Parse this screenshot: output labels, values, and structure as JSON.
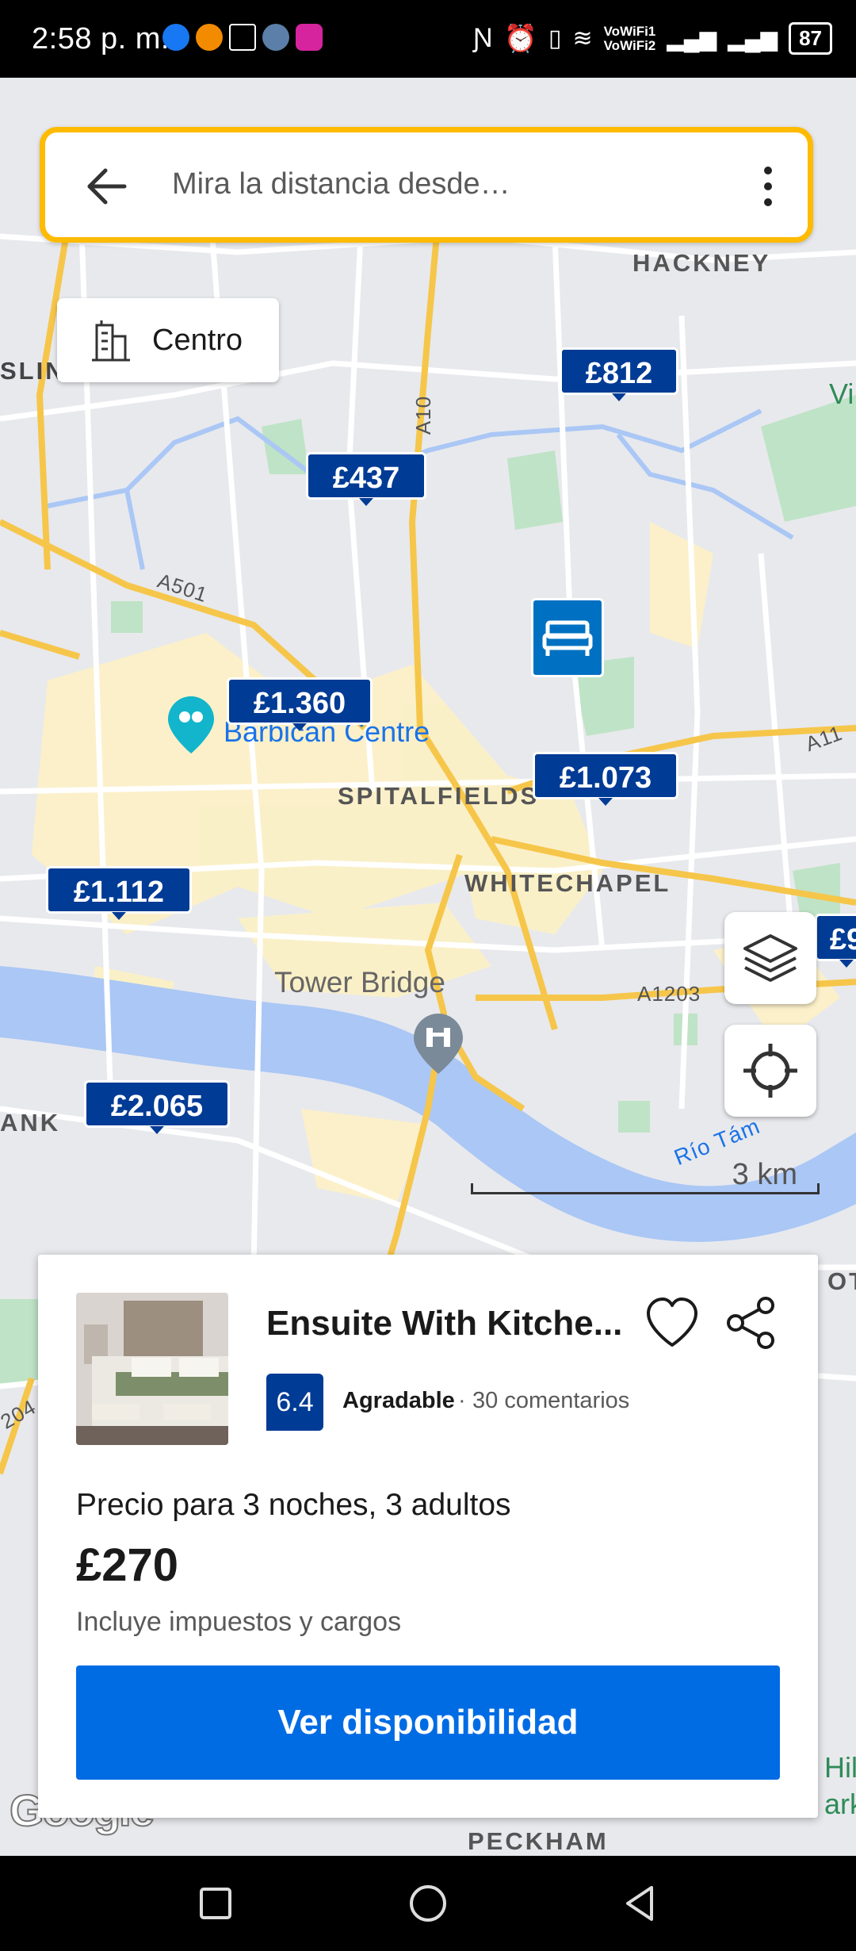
{
  "status_bar": {
    "time": "2:58 p. m.",
    "network_label_1": "VoWiFi1",
    "network_label_2": "VoWiFi2",
    "battery": "87"
  },
  "search": {
    "placeholder": "Mira la distancia desde…"
  },
  "centro_button": {
    "label": "Centro",
    "icon": "buildings-icon"
  },
  "map": {
    "labels": {
      "hackney": "HACKNEY",
      "islington_partial": "SLIN",
      "vi_partial": "Vi",
      "a10": "A10",
      "a501": "A501",
      "a11": "A11",
      "barbican": "Barbican Centre",
      "spitalfields": "SPITALFIELDS",
      "whitechapel": "WHITECHAPEL",
      "tower_bridge": "Tower Bridge",
      "a1203": "A1203",
      "rio_tamesis": "Río Tám",
      "bank_partial": "ANK",
      "peckham": "PECKHAM",
      "oth_partial": "OTH",
      "hill_partial": "Hill",
      "ark_partial": "ark",
      "road_04": "204",
      "google": "Google"
    },
    "price_pins": [
      "£812",
      "£437",
      "£1.360",
      "£1.073",
      "£1.112",
      "£2.065",
      "£9"
    ],
    "scale_label": "3 km"
  },
  "card": {
    "title": "Ensuite With Kitche...",
    "score": "6.4",
    "score_label": "Agradable",
    "separator": "·",
    "reviews": "30 comentarios",
    "price_desc": "Precio para 3 noches, 3 adultos",
    "price": "£270",
    "taxes": "Incluye impuestos y cargos",
    "cta": "Ver disponibilidad"
  },
  "colors": {
    "brand_blue": "#003b95",
    "cta_blue": "#006ce4",
    "search_border": "#febb02",
    "water": "#aac7f5",
    "road": "#f6c64a"
  }
}
